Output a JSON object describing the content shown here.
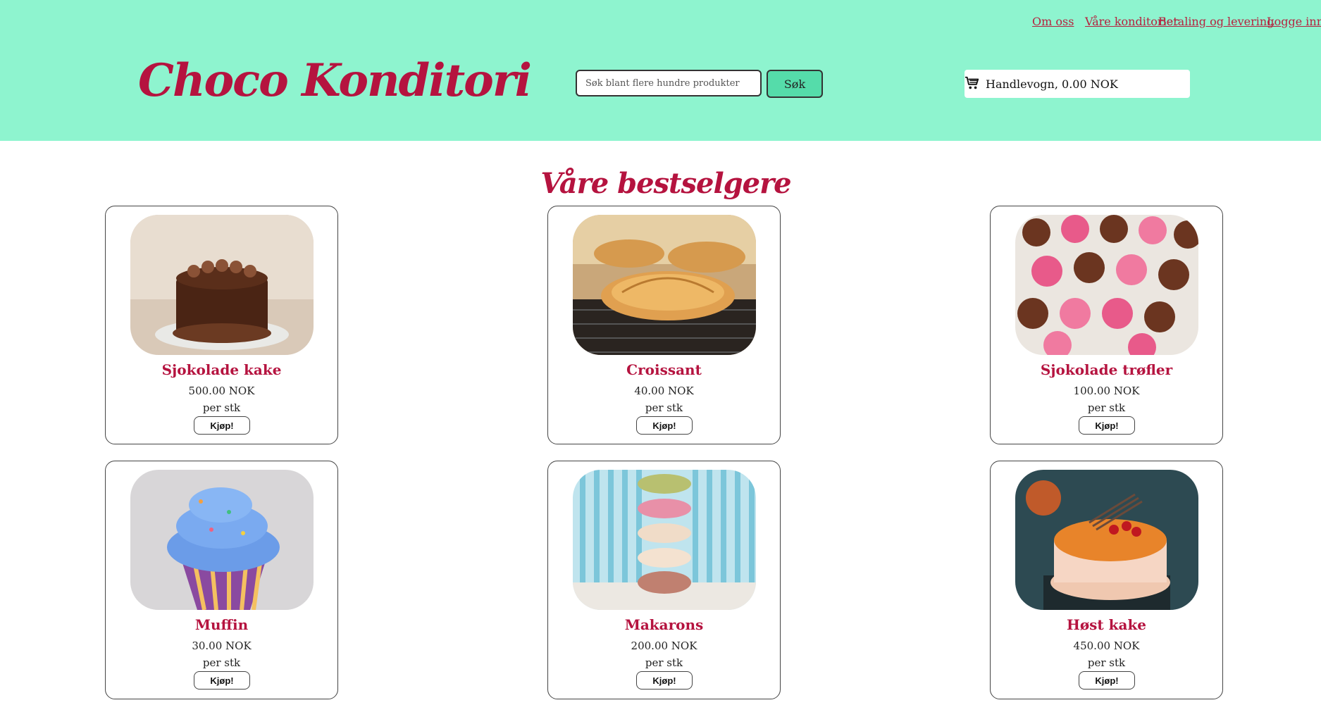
{
  "nav": {
    "links": [
      "Om oss",
      "Våre konditorier",
      "Betaling og levering",
      "Logge inn"
    ]
  },
  "brand": {
    "logo_text": "Choco Konditori"
  },
  "search": {
    "placeholder": "Søk blant flere hundre produkter",
    "button_label": "Søk"
  },
  "cart": {
    "label": "Handlevogn, 0.00 NOK",
    "icon": "cart-icon"
  },
  "main": {
    "title": "Våre bestselgere",
    "products": [
      {
        "name": "Sjokolade kake",
        "price": "500.00 NOK",
        "unit": "per stk",
        "button": "Kjøp!"
      },
      {
        "name": "Croissant",
        "price": "40.00 NOK",
        "unit": "per stk",
        "button": "Kjøp!"
      },
      {
        "name": "Sjokolade trøfler",
        "price": "100.00 NOK",
        "unit": "per stk",
        "button": "Kjøp!"
      },
      {
        "name": "Muffin",
        "price": "30.00 NOK",
        "unit": "per stk",
        "button": "Kjøp!"
      },
      {
        "name": "Makarons",
        "price": "200.00 NOK",
        "unit": "per stk",
        "button": "Kjøp!"
      },
      {
        "name": "Høst kake",
        "price": "450.00 NOK",
        "unit": "per stk",
        "button": "Kjøp!"
      }
    ]
  },
  "colors": {
    "header_bg": "#8ef4cf",
    "accent": "#b5133f",
    "search_button": "#55dcaa"
  }
}
